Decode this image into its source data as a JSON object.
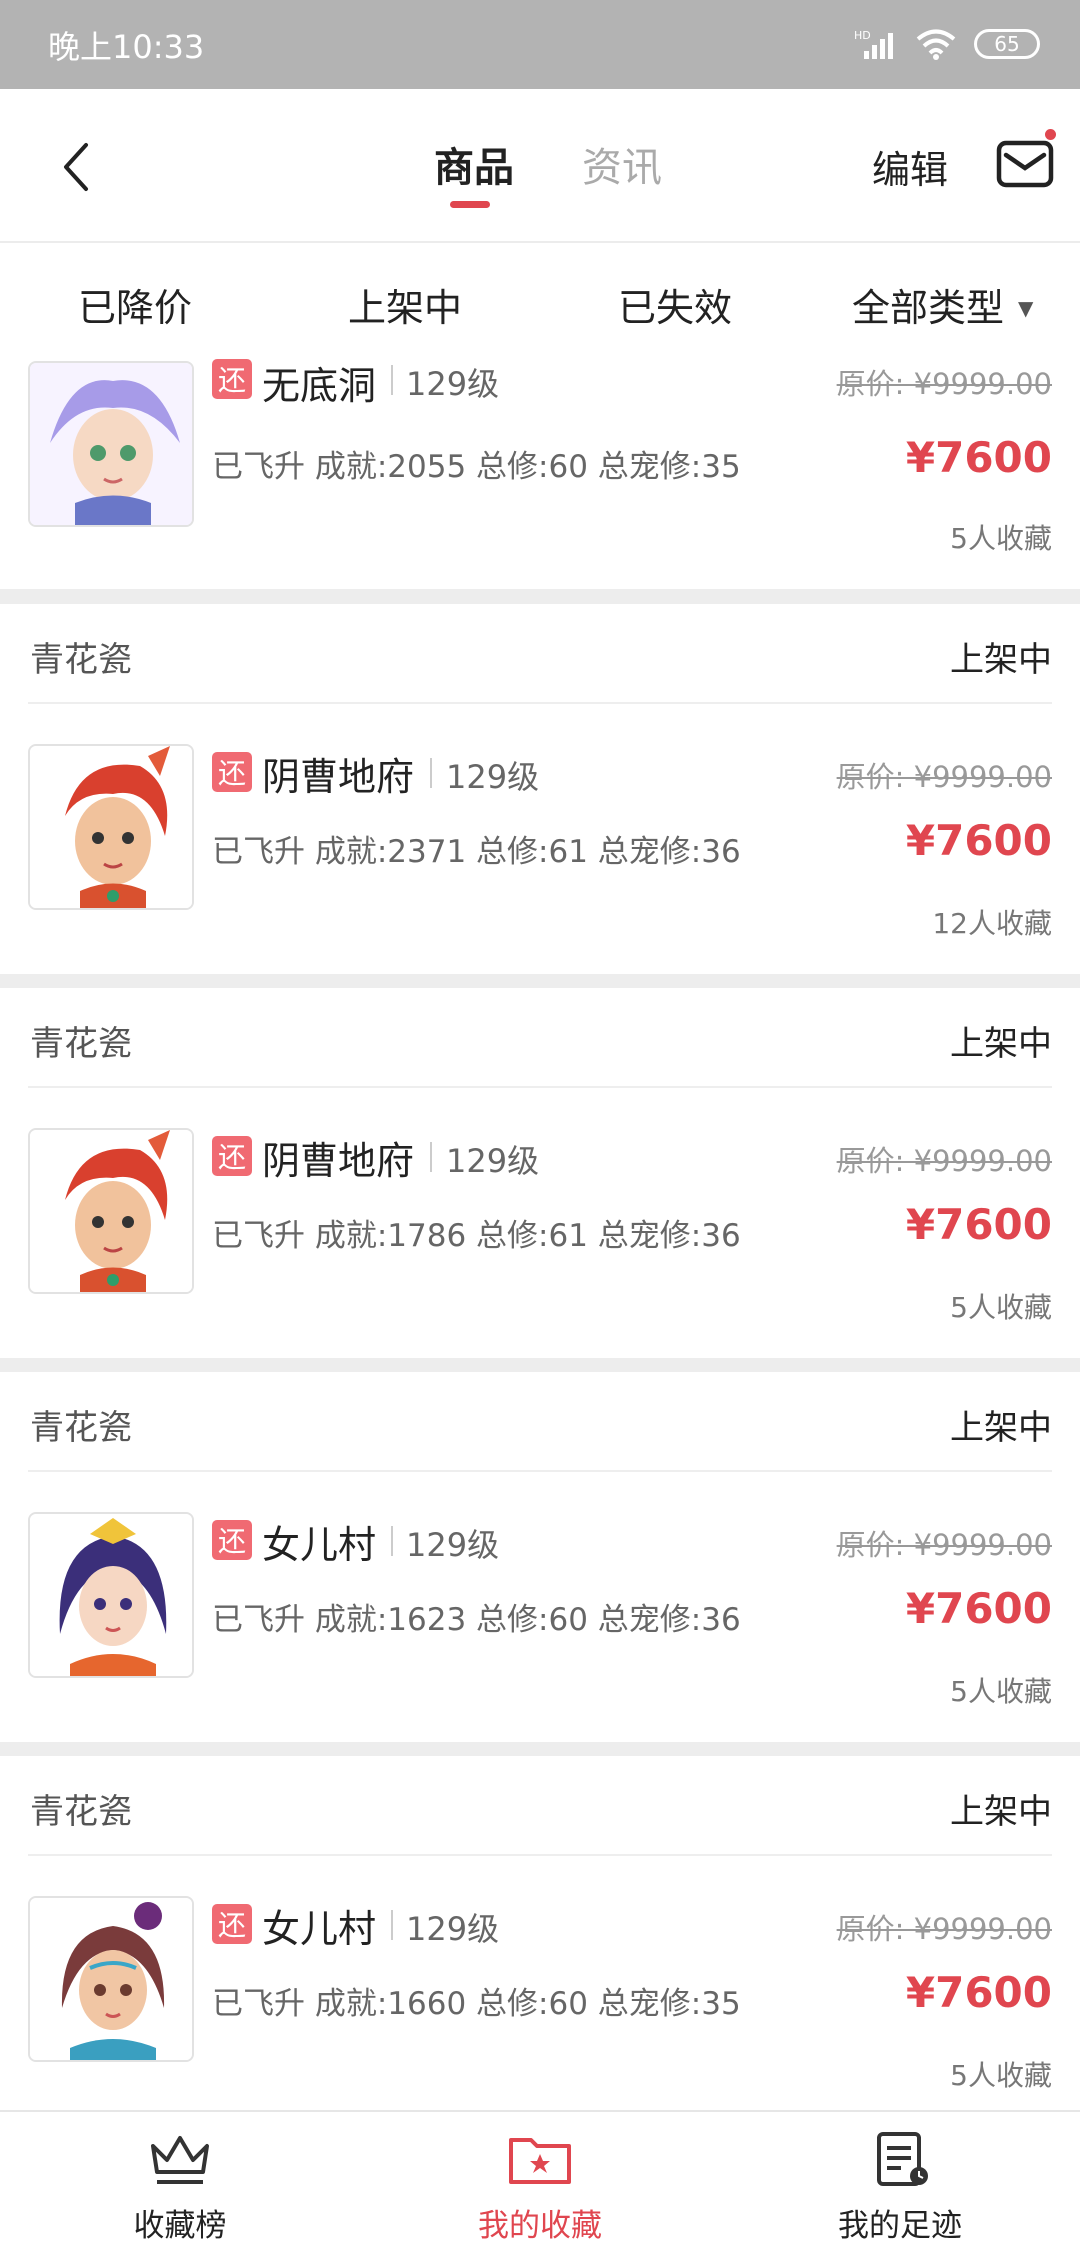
{
  "status_bar": {
    "time": "晚上10:33",
    "network": "HD",
    "battery": "65"
  },
  "header": {
    "tabs": [
      "商品",
      "资讯"
    ],
    "active_tab": "商品",
    "edit_label": "编辑",
    "accent_color": "#e0464f"
  },
  "filters": {
    "items": [
      "已降价",
      "上架中",
      "已失效"
    ],
    "type_select": "全部类型"
  },
  "items": [
    {
      "seller": "",
      "state": "",
      "tag": "还",
      "server": "无底洞",
      "level": "129级",
      "desc": "已飞升 成就:2055 总修:60 总宠修:35",
      "original_price": "原价: ¥9999.00",
      "price": "¥7600",
      "favorites": "5人收藏"
    },
    {
      "seller": "青花瓷",
      "state": "上架中",
      "tag": "还",
      "server": "阴曹地府",
      "level": "129级",
      "desc": "已飞升 成就:2371 总修:61 总宠修:36",
      "original_price": "原价: ¥9999.00",
      "price": "¥7600",
      "favorites": "12人收藏"
    },
    {
      "seller": "青花瓷",
      "state": "上架中",
      "tag": "还",
      "server": "阴曹地府",
      "level": "129级",
      "desc": "已飞升 成就:1786 总修:61 总宠修:36",
      "original_price": "原价: ¥9999.00",
      "price": "¥7600",
      "favorites": "5人收藏"
    },
    {
      "seller": "青花瓷",
      "state": "上架中",
      "tag": "还",
      "server": "女儿村",
      "level": "129级",
      "desc": "已飞升 成就:1623 总修:60 总宠修:36",
      "original_price": "原价: ¥9999.00",
      "price": "¥7600",
      "favorites": "5人收藏"
    },
    {
      "seller": "青花瓷",
      "state": "上架中",
      "tag": "还",
      "server": "女儿村",
      "level": "129级",
      "desc": "已飞升 成就:1660 总修:60 总宠修:35",
      "original_price": "原价: ¥9999.00",
      "price": "¥7600",
      "favorites": "5人收藏"
    }
  ],
  "bottom_nav": [
    {
      "label": "收藏榜",
      "icon": "crown-icon"
    },
    {
      "label": "我的收藏",
      "icon": "star-folder-icon",
      "active": true
    },
    {
      "label": "我的足迹",
      "icon": "history-doc-icon"
    }
  ]
}
